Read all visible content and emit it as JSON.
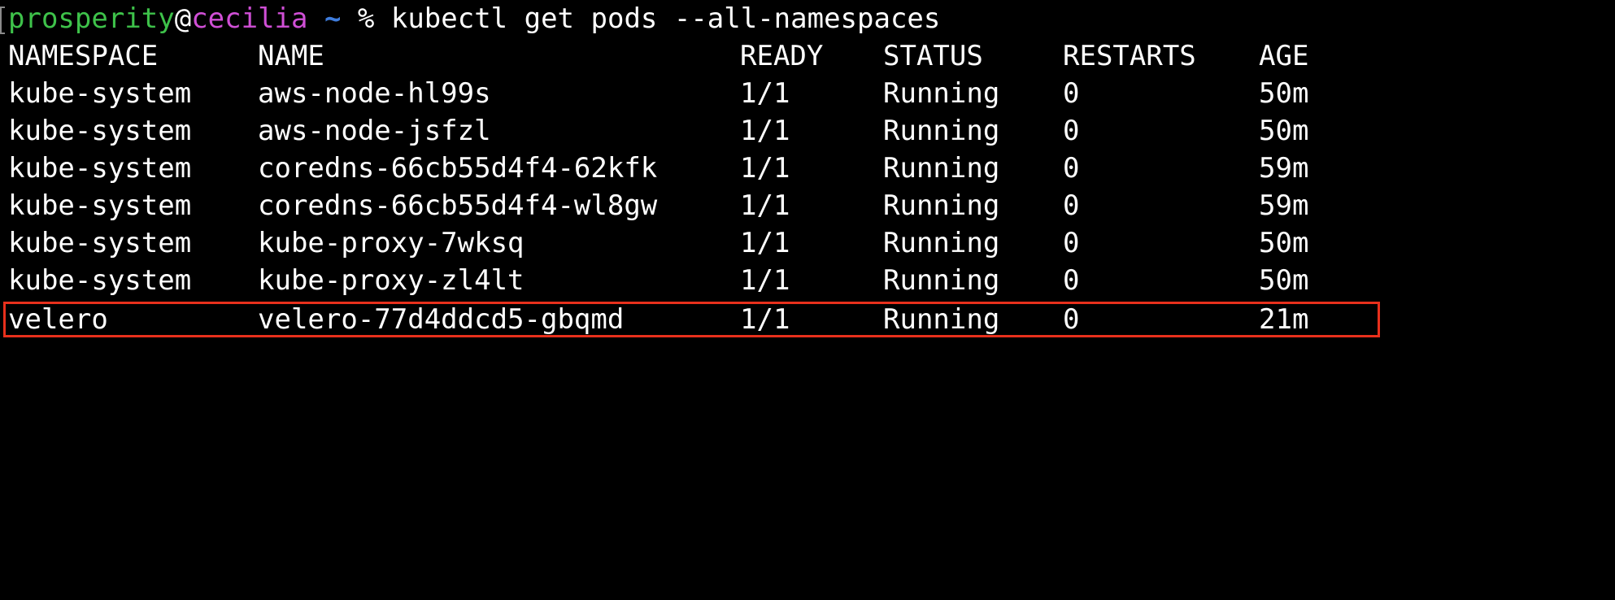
{
  "prompt": {
    "user": "prosperity",
    "at": "@",
    "host": "cecilia",
    "tilde": "~",
    "command": " % kubectl get pods --all-namespaces"
  },
  "table": {
    "headers": {
      "namespace": "NAMESPACE",
      "name": "NAME",
      "ready": "READY",
      "status": "STATUS",
      "restarts": "RESTARTS",
      "age": "AGE"
    },
    "rows": [
      {
        "namespace": "kube-system",
        "name": "aws-node-hl99s",
        "ready": "1/1",
        "status": "Running",
        "restarts": "0",
        "age": "50m"
      },
      {
        "namespace": "kube-system",
        "name": "aws-node-jsfzl",
        "ready": "1/1",
        "status": "Running",
        "restarts": "0",
        "age": "50m"
      },
      {
        "namespace": "kube-system",
        "name": "coredns-66cb55d4f4-62kfk",
        "ready": "1/1",
        "status": "Running",
        "restarts": "0",
        "age": "59m"
      },
      {
        "namespace": "kube-system",
        "name": "coredns-66cb55d4f4-wl8gw",
        "ready": "1/1",
        "status": "Running",
        "restarts": "0",
        "age": "59m"
      },
      {
        "namespace": "kube-system",
        "name": "kube-proxy-7wksq",
        "ready": "1/1",
        "status": "Running",
        "restarts": "0",
        "age": "50m"
      },
      {
        "namespace": "kube-system",
        "name": "kube-proxy-zl4lt",
        "ready": "1/1",
        "status": "Running",
        "restarts": "0",
        "age": "50m"
      },
      {
        "namespace": "velero",
        "name": "velero-77d4ddcd5-gbqmd",
        "ready": "1/1",
        "status": "Running",
        "restarts": "0",
        "age": "21m"
      }
    ]
  },
  "colors": {
    "background": "#000000",
    "text": "#ffffff",
    "user": "#3ec24a",
    "host": "#d04fd6",
    "tilde": "#3f7dde",
    "highlight_border": "#e8301c"
  }
}
